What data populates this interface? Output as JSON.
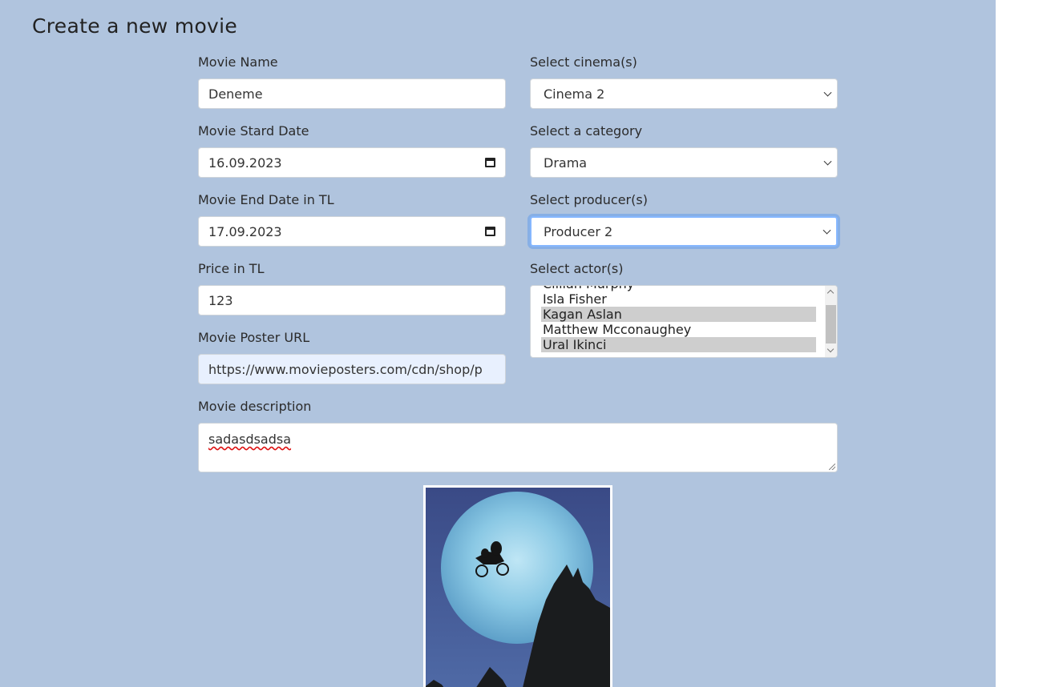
{
  "page": {
    "title": "Create a new movie"
  },
  "form": {
    "movie_name": {
      "label": "Movie Name",
      "value": "Deneme"
    },
    "start_date": {
      "label": "Movie Stard Date",
      "value": "16.09.2023"
    },
    "end_date": {
      "label": "Movie End Date in TL",
      "value": "17.09.2023"
    },
    "price": {
      "label": "Price in TL",
      "value": "123"
    },
    "poster_url": {
      "label": "Movie Poster URL",
      "value": "https://www.movieposters.com/cdn/shop/p"
    },
    "cinemas": {
      "label": "Select cinema(s)",
      "value": "Cinema 2"
    },
    "category": {
      "label": "Select a category",
      "value": "Drama"
    },
    "producers": {
      "label": "Select producer(s)",
      "value": "Producer 2"
    },
    "actors": {
      "label": "Select actor(s)",
      "options": [
        {
          "label": "Cillian Murphy",
          "selected": false
        },
        {
          "label": "Isla Fisher",
          "selected": false
        },
        {
          "label": "Kagan Aslan",
          "selected": true
        },
        {
          "label": "Matthew Mcconaughey",
          "selected": false
        },
        {
          "label": "Ural Ikinci",
          "selected": true
        }
      ]
    },
    "description": {
      "label": "Movie description",
      "value": "sadasdsadsa"
    }
  },
  "colors": {
    "page_bg": "#b0c4de",
    "focus_ring": "#86b7fe",
    "selected_option": "#cecece",
    "autofill_bg": "#e8f0fe"
  },
  "icons": {
    "date": "calendar-icon",
    "select": "chevron-down-icon"
  }
}
